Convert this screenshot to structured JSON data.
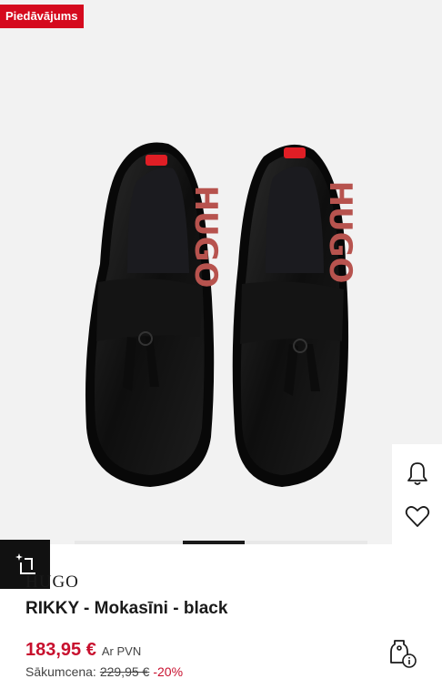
{
  "badge": {
    "label": "Piedāvājums"
  },
  "product": {
    "brand": "HUGO",
    "title": "RIKKY - Mokasīni - black",
    "image_logo_text": "HUGO"
  },
  "gallery": {
    "current_index": 0.37,
    "segment_fraction": 0.21
  },
  "price": {
    "current": "183,95 €",
    "vat_note": "Ar PVN",
    "original_label": "Sākumcena:",
    "original": "229,95 €",
    "discount": "-20%"
  },
  "colors": {
    "accent_red": "#d50a1e",
    "price_red": "#c8102e",
    "dark": "#111111"
  },
  "icons": [
    "bell-icon",
    "heart-icon",
    "sparkle-crop-icon",
    "price-tag-info-icon"
  ]
}
